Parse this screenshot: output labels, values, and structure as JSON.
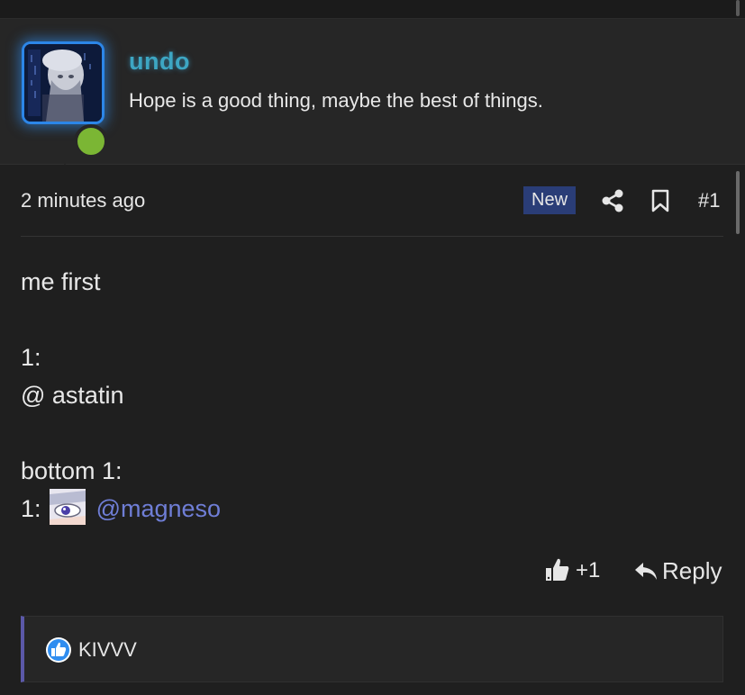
{
  "author": {
    "username": "undo",
    "signature": "Hope is a good thing, maybe the best of things.",
    "online": true
  },
  "post_meta": {
    "time": "2 minutes ago",
    "badge": "New",
    "post_number": "#1"
  },
  "content": {
    "line1": "me first",
    "line2": "1:",
    "line3": "@ astatin",
    "line4": "bottom 1:",
    "line5_prefix": "1:",
    "line5_mention": "@magneso"
  },
  "actions": {
    "like_count": "+1",
    "reply_label": "Reply"
  },
  "reactions": {
    "user": "KIVVV"
  },
  "colors": {
    "background": "#1f1f1f",
    "username": "#3da6c3",
    "badge": "#2a3d77",
    "mention": "#6f7ed6",
    "online": "#7bb634",
    "reaction_border": "#5b58a8"
  }
}
